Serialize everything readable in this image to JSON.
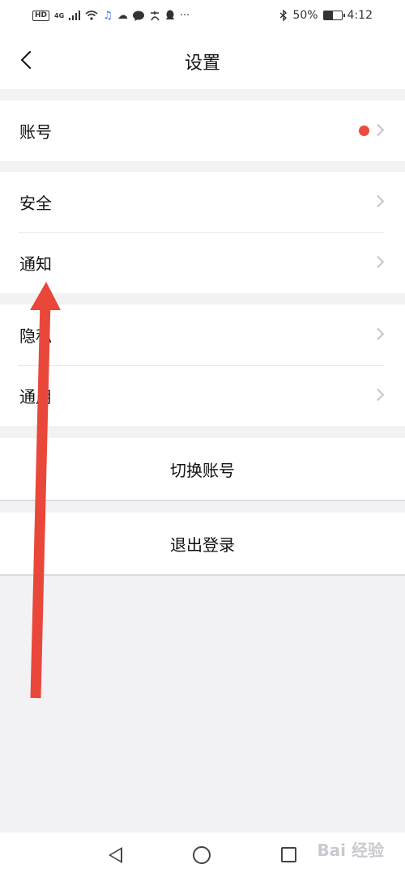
{
  "status_bar": {
    "hd": "HD",
    "network": "4G",
    "battery": "50%",
    "battery_level": 0.5,
    "time": "4:12",
    "icons": [
      "hd-icon",
      "signal-icon",
      "wifi-icon",
      "music-icon",
      "cloud-icon",
      "chat-icon",
      "alipay-icon",
      "qq-icon",
      "more-icon",
      "bluetooth-icon",
      "battery-icon"
    ]
  },
  "header": {
    "title": "设置"
  },
  "groups": {
    "account": {
      "label": "账号"
    },
    "security": {
      "label": "安全"
    },
    "notification": {
      "label": "通知"
    },
    "privacy": {
      "label": "隐私"
    },
    "general": {
      "label": "通用"
    }
  },
  "actions": {
    "switch_account": "切换账号",
    "logout": "退出登录"
  },
  "watermark": "Bai 经验",
  "colors": {
    "red_dot": "#ee4b3a",
    "arrow": "#e9473a",
    "background": "#f2f2f5"
  }
}
